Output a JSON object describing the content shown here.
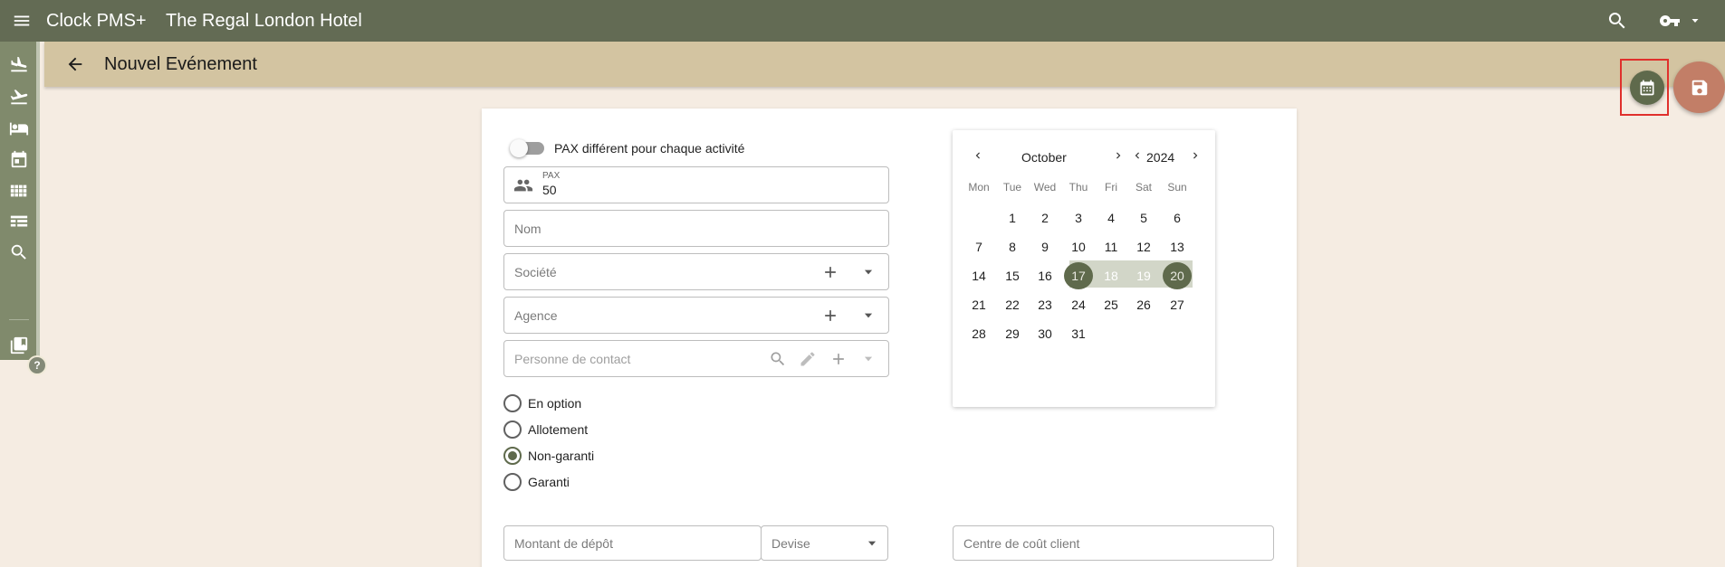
{
  "topbar": {
    "app_title": "Clock PMS+",
    "hotel_name": "The Regal London Hotel",
    "icons": [
      "menu-icon",
      "search-icon",
      "key-icon",
      "caret-down-icon"
    ]
  },
  "rail": {
    "items": [
      "arrivals-icon",
      "departures-icon",
      "rooms-icon",
      "calendar-icon",
      "grid-icon",
      "table-icon",
      "search-icon",
      "bookmark-icon"
    ],
    "help_label": "?"
  },
  "header": {
    "title": "Nouvel Evénement"
  },
  "form": {
    "pax_toggle_label": "PAX différent pour chaque activité",
    "pax_toggle_on": false,
    "pax_label": "PAX",
    "pax_value": "50",
    "nom_placeholder": "Nom",
    "societe_placeholder": "Société",
    "agence_placeholder": "Agence",
    "contact_placeholder": "Personne de contact",
    "status_options": [
      "En option",
      "Allotement",
      "Non-garanti",
      "Garanti"
    ],
    "status_selected": "Non-garanti",
    "depot_placeholder": "Montant de dépôt",
    "devise_placeholder": "Devise",
    "centre_placeholder": "Centre de coût client"
  },
  "calendar": {
    "month": "October",
    "year": "2024",
    "weekdays": [
      "Mon",
      "Tue",
      "Wed",
      "Thu",
      "Fri",
      "Sat",
      "Sun"
    ],
    "days": [
      "1",
      "2",
      "3",
      "4",
      "5",
      "6",
      "7",
      "8",
      "9",
      "10",
      "11",
      "12",
      "13",
      "14",
      "15",
      "16",
      "17",
      "18",
      "19",
      "20",
      "21",
      "22",
      "23",
      "24",
      "25",
      "26",
      "27",
      "28",
      "29",
      "30",
      "31"
    ],
    "first_weekday_offset": 1,
    "range_start": "17",
    "range_end": "20",
    "accent": "#5f6a4c",
    "range_color": "#d2d6c8"
  },
  "colors": {
    "topbar": "#636b54",
    "header": "#d3c4a1",
    "background": "#f5ece2",
    "save_fab": "#c27e67",
    "calendar_fab": "#5f6a4c"
  }
}
